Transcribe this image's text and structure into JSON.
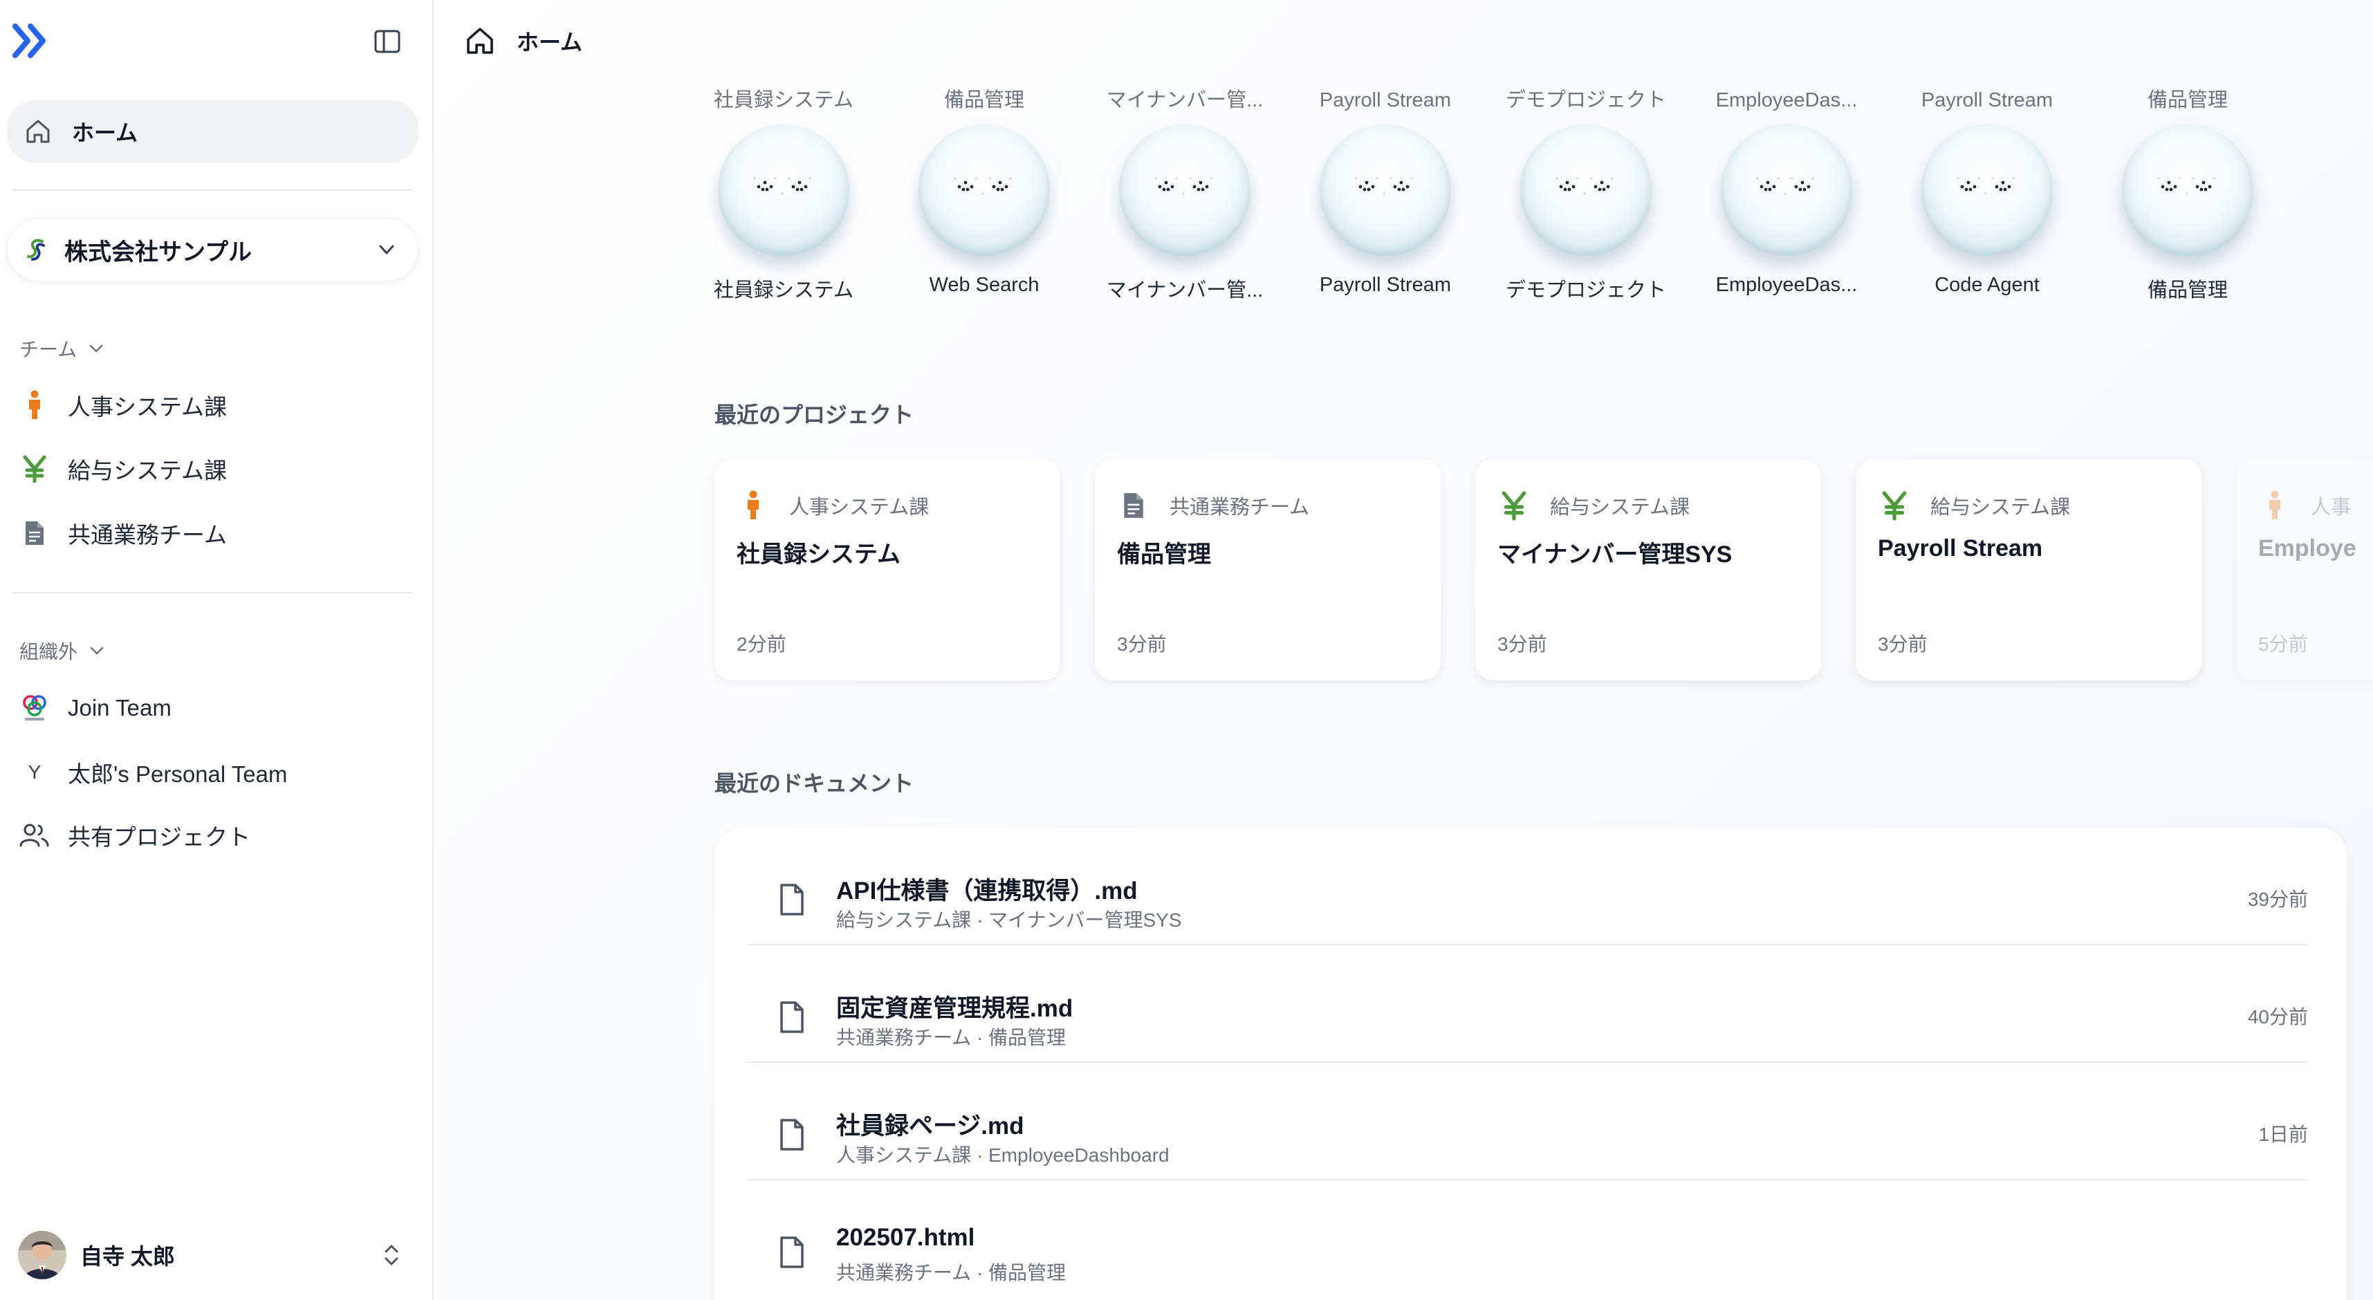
{
  "sidebar": {
    "home_label": "ホーム",
    "org_name": "株式会社サンプル",
    "team_section_label": "チーム",
    "teams": [
      {
        "label": "人事システム課",
        "icon": "person-icon",
        "color": "#ea7c1e"
      },
      {
        "label": "給与システム課",
        "icon": "yen-icon",
        "color": "#4d9a3a"
      },
      {
        "label": "共通業務チーム",
        "icon": "document-icon",
        "color": "#6b7280"
      }
    ],
    "external_section_label": "組織外",
    "external": [
      {
        "label": "Join Team",
        "icon": "join-logo-icon"
      },
      {
        "label": "太郎's Personal Team",
        "icon": "initial-badge-icon",
        "initial": "Y"
      },
      {
        "label": "共有プロジェクト",
        "icon": "users-icon"
      }
    ],
    "user_name": "自寺 太郎"
  },
  "header": {
    "title": "ホーム"
  },
  "agents": [
    {
      "project": "社員録システム",
      "name": "社員録システム"
    },
    {
      "project": "備品管理",
      "name": "Web Search"
    },
    {
      "project": "マイナンバー管...",
      "name": "マイナンバー管..."
    },
    {
      "project": "Payroll Stream",
      "name": "Payroll Stream"
    },
    {
      "project": "デモプロジェクト",
      "name": "デモプロジェクト"
    },
    {
      "project": "EmployeeDas...",
      "name": "EmployeeDas..."
    },
    {
      "project": "Payroll Stream",
      "name": "Code Agent"
    },
    {
      "project": "備品管理",
      "name": "備品管理"
    }
  ],
  "recent_projects": {
    "heading": "最近のプロジェクト",
    "items": [
      {
        "team": "人事システム課",
        "team_icon": "person-icon",
        "name": "社員録システム",
        "time": "2分前"
      },
      {
        "team": "共通業務チーム",
        "team_icon": "document-icon",
        "name": "備品管理",
        "time": "3分前"
      },
      {
        "team": "給与システム課",
        "team_icon": "yen-icon",
        "name": "マイナンバー管理SYS",
        "time": "3分前"
      },
      {
        "team": "給与システム課",
        "team_icon": "yen-icon",
        "name": "Payroll Stream",
        "time": "3分前"
      },
      {
        "team": "人事",
        "team_icon": "person-icon",
        "name": "Employe",
        "time": "5分前"
      }
    ]
  },
  "recent_documents": {
    "heading": "最近のドキュメント",
    "items": [
      {
        "title": "API仕様書（連携取得）.md",
        "path": "給与システム課 · マイナンバー管理SYS",
        "time": "39分前"
      },
      {
        "title": "固定資産管理規程.md",
        "path": "共通業務チーム · 備品管理",
        "time": "40分前"
      },
      {
        "title": "社員録ページ.md",
        "path": "人事システム課 · EmployeeDashboard",
        "time": "1日前"
      },
      {
        "title": "202507.html",
        "path": "共通業務チーム · 備品管理",
        "time": ""
      }
    ]
  },
  "colors": {
    "accent_blue": "#2563eb",
    "person_orange": "#ea7c1e",
    "yen_green": "#4d9a3a"
  }
}
